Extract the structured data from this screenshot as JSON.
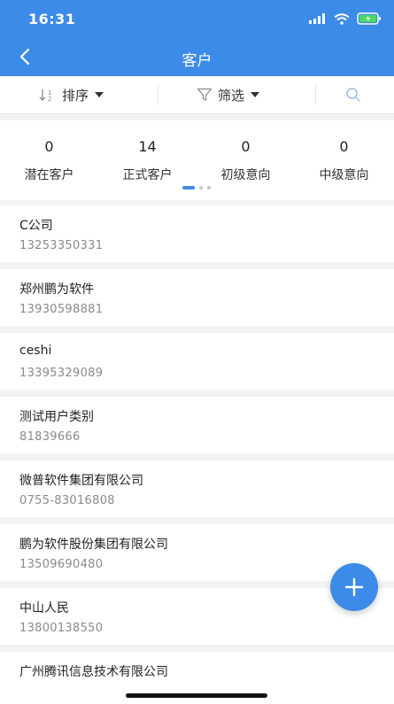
{
  "status": {
    "time": "16:31"
  },
  "header": {
    "title": "客户"
  },
  "toolbar": {
    "sort_label": "排序",
    "filter_label": "筛选"
  },
  "stats": [
    {
      "count": "0",
      "label": "潜在客户"
    },
    {
      "count": "14",
      "label": "正式客户"
    },
    {
      "count": "0",
      "label": "初级意向"
    },
    {
      "count": "0",
      "label": "中级意向"
    }
  ],
  "customers": [
    {
      "name": "C公司",
      "phone": "13253350331"
    },
    {
      "name": "郑州鹏为软件",
      "phone": "13930598881"
    },
    {
      "name": "ceshi",
      "phone": "13395329089"
    },
    {
      "name": "测试用户类别",
      "phone": "81839666"
    },
    {
      "name": "微普软件集团有限公司",
      "phone": "0755-83016808"
    },
    {
      "name": "鹏为软件股份集团有限公司",
      "phone": "13509690480"
    },
    {
      "name": "中山人民",
      "phone": "13800138550"
    },
    {
      "name": "广州腾讯信息技术有限公司",
      "phone": ""
    }
  ],
  "icons": {
    "back": "chevron-left-icon",
    "sort": "sort-icon",
    "filter": "filter-icon",
    "search": "search-icon",
    "add": "plus-icon"
  },
  "colors": {
    "accent": "#3d8be8",
    "background": "#f2f3f5"
  }
}
